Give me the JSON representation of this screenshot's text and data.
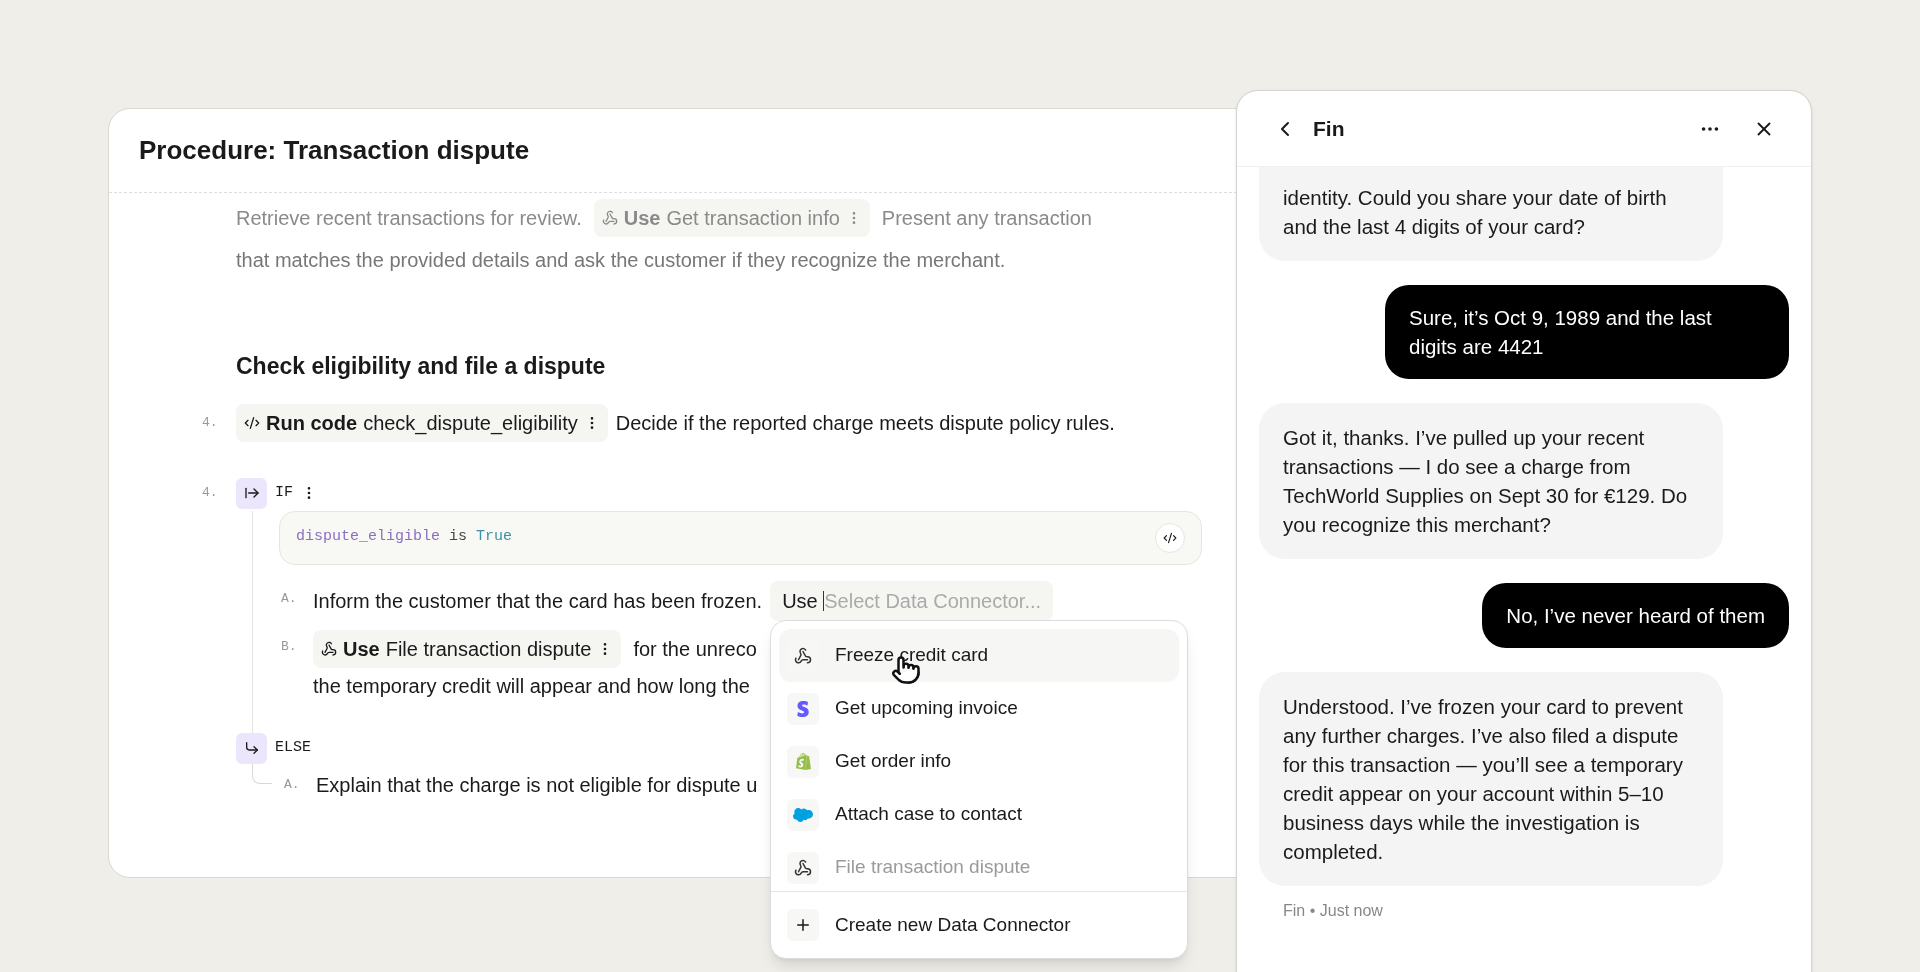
{
  "procedure": {
    "title": "Procedure: Transaction dispute",
    "faded_step": {
      "text_before": "Retrieve recent transactions for review.",
      "chip": {
        "verb": "Use",
        "name": "Get transaction info"
      },
      "text_after": "Present any transaction",
      "continuation": "that matches the provided details and ask the customer if they recognize the merchant."
    },
    "section_heading": "Check eligibility and file a dispute",
    "code_step": {
      "number": "4.",
      "chip": {
        "verb": "Run code",
        "name": "check_dispute_eligibility"
      },
      "text": "Decide if the reported charge meets dispute policy rules."
    },
    "condition": {
      "number": "4.",
      "keyword": "IF",
      "expression": {
        "variable": "dispute_eligible",
        "operator": "is",
        "value": "True"
      },
      "then": [
        {
          "kind": "input",
          "letter": "A.",
          "text": "Inform the customer that the card has been frozen.",
          "input": {
            "prefix": "Use",
            "placeholder": "Select Data Connector..."
          }
        },
        {
          "kind": "chip",
          "letter": "B.",
          "chip": {
            "verb": "Use",
            "name": "File transaction dispute"
          },
          "text": "for the unreco",
          "continuation": "the temporary credit will appear and how long the"
        }
      ],
      "else_keyword": "ELSE",
      "else": [
        {
          "letter": "A.",
          "text": "Explain that the charge is not eligible for dispute u"
        }
      ]
    }
  },
  "dropdown": {
    "items": [
      {
        "label": "Freeze credit card",
        "kind": "webhook",
        "selected": true,
        "faded": false
      },
      {
        "label": "Get upcoming invoice",
        "kind": "stripe",
        "selected": false,
        "faded": false
      },
      {
        "label": "Get order info",
        "kind": "shopify",
        "selected": false,
        "faded": false
      },
      {
        "label": "Attach case to contact",
        "kind": "salesforce",
        "selected": false,
        "faded": false
      },
      {
        "label": "File transaction dispute",
        "kind": "webhook",
        "selected": false,
        "faded": true
      }
    ],
    "footer": "Create new Data Connector"
  },
  "chat": {
    "title": "Fin",
    "messages": [
      {
        "kind": "bot",
        "text": "identity. Could you share your date of birth and the last 4 digits of your card?"
      },
      {
        "kind": "user",
        "text": "Sure, it’s Oct 9, 1989 and the last digits are 4421"
      },
      {
        "kind": "bot",
        "text": "Got it, thanks. I’ve pulled up your recent transactions — I do see a charge from TechWorld Supplies on Sept 30 for €129. Do you recognize this merchant?"
      },
      {
        "kind": "user",
        "text": "No, I’ve never heard of them"
      },
      {
        "kind": "bot",
        "text": "Understood. I’ve frozen your card to prevent any further charges. I’ve also filed a dispute for this transaction — you’ll see a temporary credit appear on your account within 5–10 business days while the investigation is completed."
      }
    ],
    "meta": {
      "sender": "Fin",
      "separator": "•",
      "time": "Just now"
    }
  }
}
